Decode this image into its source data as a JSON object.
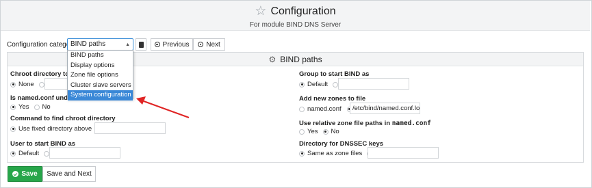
{
  "header": {
    "title": "Configuration",
    "subtitle": "For module BIND DNS Server"
  },
  "toolbar": {
    "category_label": "Configuration category",
    "category_value": "BIND paths",
    "previous_label": "Previous",
    "next_label": "Next"
  },
  "dropdown": {
    "options": [
      "BIND paths",
      "Display options",
      "Zone file options",
      "Cluster slave servers",
      "System configuration"
    ],
    "highlighted": "System configuration"
  },
  "panel": {
    "title": "BIND paths",
    "left": {
      "chroot": {
        "label": "Chroot directory to run",
        "opt1": "None"
      },
      "named_conf": {
        "label": "Is named.conf under c",
        "opt_yes": "Yes",
        "opt_no": "No"
      },
      "find_chroot": {
        "label": "Command to find chroot directory",
        "opt1": "Use fixed directory above"
      },
      "user": {
        "label": "User to start BIND as",
        "opt1": "Default"
      }
    },
    "right": {
      "group": {
        "label": "Group to start BIND as",
        "opt1": "Default"
      },
      "add_zones": {
        "label": "Add new zones to file",
        "opt1": "named.conf",
        "path_value": "/etc/bind/named.conf.loc"
      },
      "relative": {
        "label_prefix": "Use relative zone file paths in ",
        "label_mono": "named.conf",
        "opt_yes": "Yes",
        "opt_no": "No"
      },
      "dnssec": {
        "label": "Directory for DNSSEC keys",
        "opt1": "Same as zone files"
      }
    }
  },
  "buttons": {
    "save": "Save",
    "save_next": "Save and Next"
  },
  "colors": {
    "save_green": "#27a64a",
    "annotation_arrow": "#e02424",
    "selection_blue": "#3a88d7"
  }
}
